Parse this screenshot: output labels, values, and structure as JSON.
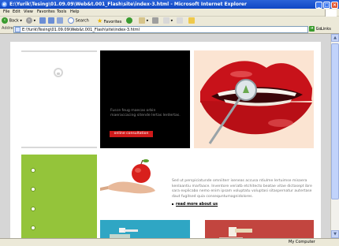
{
  "window": {
    "title": "file:///E:/Tesing/01/09/09/Website/01_Flash/site/index-3.html - Microsoft Internet Explorer",
    "title_display": "E:\\Yurik\\Tesing\\01.09.09\\Web&t.001_Flash\\site\\index-3.html - Microsoft Internet Explorer",
    "ie_logo": "e"
  },
  "menu": [
    "File",
    "Edit",
    "View",
    "Favorites",
    "Tools",
    "Help"
  ],
  "toolbar": {
    "back_label": "Back",
    "search_label": "Search",
    "favorites_label": "Favorites"
  },
  "address": {
    "label": "Address",
    "url": "E:\\Yurik\\Tesing\\01.09.09\\Web&t.001_Flash\\site\\index-3.html",
    "go_label": "Go",
    "links_label": "Links"
  },
  "page": {
    "hero_text": "Fusce feug maecas orbin maeraccacing sitende lertas lerdertas.",
    "hero_button": "online consultation",
    "body_text": "Sed ut perspiciatunde omniiterr iseneas accusa ntiulme lertuimse misaera kenlaantiu marfaace. Inventore veriatb etchitecto beatae vitae dictasept ibre sara explicabo nemo enim ipsam voluptatu voluptasi sitaspernatur autertase daut fugitsed quia consequntumagnidolores.",
    "read_more": "read more about us"
  },
  "status": {
    "left": "",
    "zone": "My Computer"
  },
  "colors": {
    "xp_blue": "#0f47c4",
    "hero_black": "#000000",
    "accent_red": "#d01a1a",
    "green": "#94c43a",
    "card_blue": "#2fa6c4",
    "card_red": "#c2453f"
  }
}
